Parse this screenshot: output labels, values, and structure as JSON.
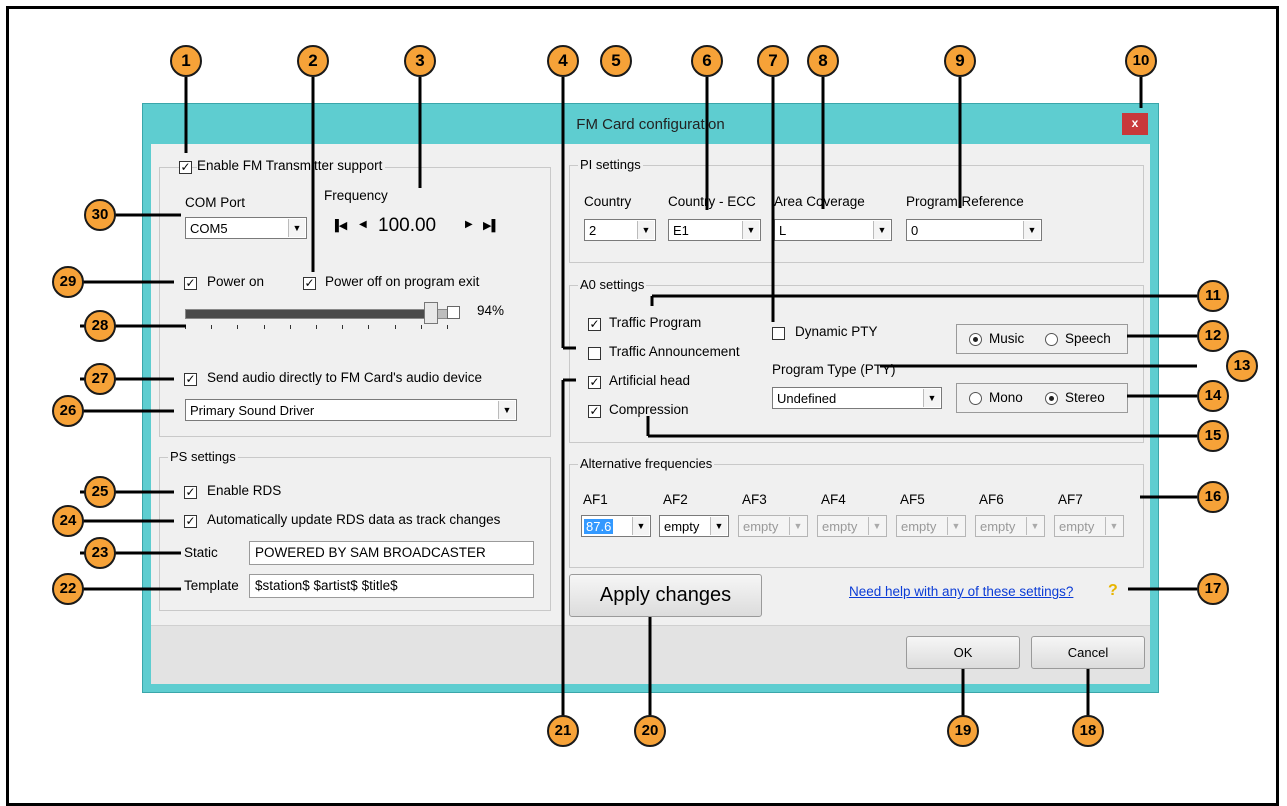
{
  "window": {
    "title": "FM Card configuration",
    "close_label": "x"
  },
  "fm_group": {
    "enable_label": "Enable FM Transmitter support",
    "com_port_label": "COM Port",
    "com_port_value": "COM5",
    "frequency_label": "Frequency",
    "frequency_value": "100.00",
    "power_on_label": "Power on",
    "power_off_label": "Power off on program exit",
    "power_percent": "94%",
    "power_level": 0.94,
    "send_audio_label": "Send audio directly to FM Card's audio device",
    "audio_device": "Primary Sound Driver"
  },
  "ps_group": {
    "title": "PS settings",
    "enable_rds_label": "Enable RDS",
    "auto_update_label": "Automatically update RDS data as track changes",
    "static_label": "Static",
    "static_value": "POWERED BY SAM BROADCASTER",
    "template_label": "Template",
    "template_value": "$station$ $artist$ $title$"
  },
  "pi_group": {
    "title": "PI settings",
    "country_label": "Country",
    "country_value": "2",
    "ecc_label": "Country - ECC",
    "ecc_value": "E1",
    "area_label": "Area Coverage",
    "area_value": "L",
    "program_ref_label": "Program Reference",
    "program_ref_value": "0"
  },
  "a0_group": {
    "title": "A0 settings",
    "traffic_program_label": "Traffic Program",
    "traffic_announcement_label": "Traffic Announcement",
    "artificial_head_label": "Artificial head",
    "compression_label": "Compression",
    "dynamic_pty_label": "Dynamic PTY",
    "music_label": "Music",
    "speech_label": "Speech",
    "pty_label": "Program Type (PTY)",
    "pty_value": "Undefined",
    "mono_label": "Mono",
    "stereo_label": "Stereo"
  },
  "af_group": {
    "title": "Alternative frequencies",
    "items": [
      {
        "label": "AF1",
        "value": "87.6"
      },
      {
        "label": "AF2",
        "value": "empty"
      },
      {
        "label": "AF3",
        "value": "empty"
      },
      {
        "label": "AF4",
        "value": "empty"
      },
      {
        "label": "AF5",
        "value": "empty"
      },
      {
        "label": "AF6",
        "value": "empty"
      },
      {
        "label": "AF7",
        "value": "empty"
      }
    ]
  },
  "buttons": {
    "apply": "Apply changes",
    "ok": "OK",
    "cancel": "Cancel"
  },
  "help_link": "Need help with any of these settings?",
  "help_icon": "?",
  "callouts": [
    "1",
    "2",
    "3",
    "4",
    "5",
    "6",
    "7",
    "8",
    "9",
    "10",
    "11",
    "12",
    "13",
    "14",
    "15",
    "16",
    "17",
    "18",
    "19",
    "20",
    "21",
    "22",
    "23",
    "24",
    "25",
    "26",
    "27",
    "28",
    "29",
    "30"
  ],
  "colors": {
    "window_frame": "#5ecdd0",
    "callout_fill": "#f6a238",
    "close_button": "#c8393b",
    "link": "#0a3bd6"
  }
}
